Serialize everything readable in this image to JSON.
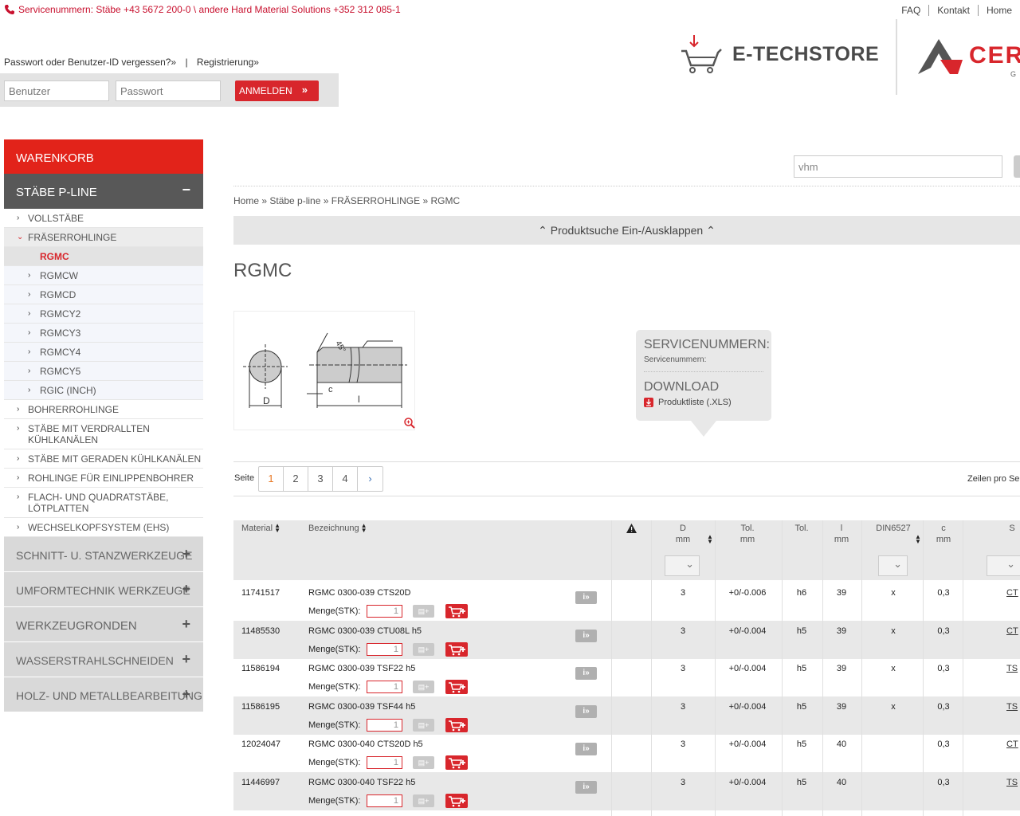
{
  "topbar": {
    "service_text": "Servicenummern: Stäbe +43 5672 200-0 \\ andere Hard Material Solutions +352 312 085-1",
    "links": [
      "FAQ",
      "Kontakt",
      "Home"
    ]
  },
  "account": {
    "forgot": "Passwort oder Benutzer-ID vergessen?»",
    "register": "Registrierung»",
    "user_placeholder": "Benutzer",
    "pass_placeholder": "Passwort",
    "login_label": "ANMELDEN"
  },
  "logos": {
    "etech": "E-TECHSTORE",
    "cer": "CER",
    "cer_sub": "G"
  },
  "sidebar": {
    "cart": "WARENKORB",
    "section": "STÄBE P-LINE",
    "items": [
      {
        "label": "VOLLSTÄBE",
        "level": 1
      },
      {
        "label": "FRÄSERROHLINGE",
        "level": 1,
        "open": true
      },
      {
        "label": "RGMC",
        "level": 2,
        "active": true
      },
      {
        "label": "RGMCW",
        "level": 2
      },
      {
        "label": "RGMCD",
        "level": 2
      },
      {
        "label": "RGMCY2",
        "level": 2
      },
      {
        "label": "RGMCY3",
        "level": 2
      },
      {
        "label": "RGMCY4",
        "level": 2
      },
      {
        "label": "RGMCY5",
        "level": 2
      },
      {
        "label": "RGIC (INCH)",
        "level": 2
      },
      {
        "label": "BOHRERROHLINGE",
        "level": 1
      },
      {
        "label": "STÄBE MIT VERDRALLTEN KÜHLKANÄLEN",
        "level": 1
      },
      {
        "label": "STÄBE MIT GERADEN KÜHLKANÄLEN",
        "level": 1
      },
      {
        "label": "ROHLINGE FÜR EINLIPPENBOHRER",
        "level": 1
      },
      {
        "label": "FLACH- UND QUADRATSTÄBE, LÖTPLATTEN",
        "level": 1
      },
      {
        "label": "WECHSELKOPFSYSTEM (EHS)",
        "level": 1
      }
    ],
    "categories": [
      "SCHNITT- U. STANZWERKZEUGE",
      "UMFORMTECHNIK WERKZEUGE",
      "WERKZEUGRONDEN",
      "WASSERSTRAHLSCHNEIDEN",
      "HOLZ- UND METALLBEARBEITUNG"
    ]
  },
  "search": {
    "value": "vhm"
  },
  "breadcrumb": [
    "Home",
    "Stäbe p-line",
    "FRÄSERROHLINGE",
    "RGMC"
  ],
  "toggle_label": "Produktsuche Ein-/Ausklappen",
  "page_title": "RGMC",
  "drawing": {
    "d": "D",
    "c": "c",
    "l": "l",
    "angle": "45°"
  },
  "service_box": {
    "heading": "SERVICENUMMERN:",
    "sub": "Servicenummern:",
    "download": "DOWNLOAD",
    "file": "Produktliste (.XLS)"
  },
  "pager": {
    "label": "Seite",
    "pages": [
      "1",
      "2",
      "3",
      "4"
    ],
    "current": "1",
    "next": "›",
    "rows_label": "Zeilen pro Se"
  },
  "table": {
    "headers": {
      "material": "Material",
      "bezeichnung": "Bezeichnung",
      "d": "D",
      "d_unit": "mm",
      "tol": "Tol.",
      "tol_unit": "mm",
      "tol2": "Tol.",
      "l": "l",
      "l_unit": "mm",
      "din": "DIN6527",
      "c": "c",
      "c_unit": "mm",
      "s": "S"
    },
    "menge_label": "Menge(STK):",
    "qty_default": "1",
    "info_label": "i»",
    "rows": [
      {
        "material": "11741517",
        "name": "RGMC 0300-039 CTS20D",
        "d": "3",
        "tol": "+0/-0.006",
        "tol2": "h6",
        "l": "39",
        "din": "x",
        "c": "0,3",
        "s": "CT"
      },
      {
        "material": "11485530",
        "name": "RGMC 0300-039 CTU08L h5",
        "d": "3",
        "tol": "+0/-0.004",
        "tol2": "h5",
        "l": "39",
        "din": "x",
        "c": "0,3",
        "s": "CT"
      },
      {
        "material": "11586194",
        "name": "RGMC 0300-039 TSF22 h5",
        "d": "3",
        "tol": "+0/-0.004",
        "tol2": "h5",
        "l": "39",
        "din": "x",
        "c": "0,3",
        "s": "TS"
      },
      {
        "material": "11586195",
        "name": "RGMC 0300-039 TSF44 h5",
        "d": "3",
        "tol": "+0/-0.004",
        "tol2": "h5",
        "l": "39",
        "din": "x",
        "c": "0,3",
        "s": "TS"
      },
      {
        "material": "12024047",
        "name": "RGMC 0300-040 CTS20D h5",
        "d": "3",
        "tol": "+0/-0.004",
        "tol2": "h5",
        "l": "40",
        "din": "",
        "c": "0,3",
        "s": "CT"
      },
      {
        "material": "11446997",
        "name": "RGMC 0300-040 TSF22 h5",
        "d": "3",
        "tol": "+0/-0.004",
        "tol2": "h5",
        "l": "40",
        "din": "",
        "c": "0,3",
        "s": "TS"
      }
    ]
  },
  "colors": {
    "accent": "#d8262c",
    "sidebar_head": "#585858",
    "stripe": "#e8e8e8"
  }
}
